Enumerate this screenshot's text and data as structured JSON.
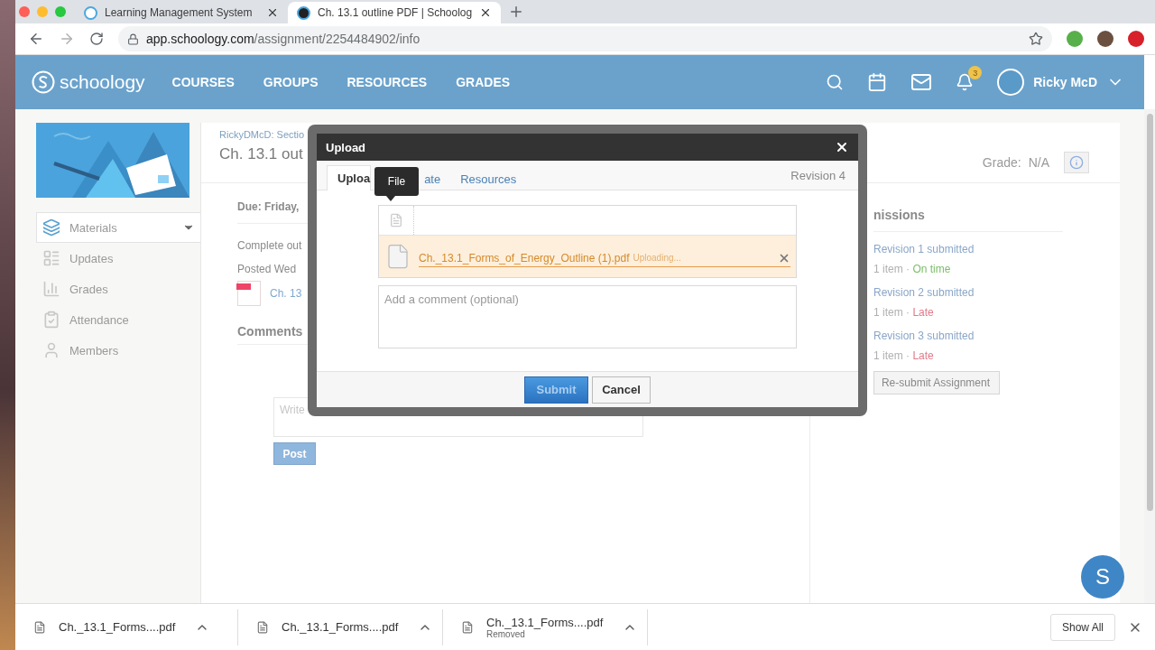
{
  "browser": {
    "tabs": [
      {
        "title": "Learning Management System",
        "selected": false
      },
      {
        "title": "Ch. 13.1 outline PDF | Schoolog",
        "selected": true
      }
    ],
    "url": {
      "host": "app.schoology.com",
      "path": "/assignment/2254484902/info"
    }
  },
  "header": {
    "logo": "schoology",
    "nav": [
      "COURSES",
      "GROUPS",
      "RESOURCES",
      "GRADES"
    ],
    "notification_count": "3",
    "user": "Ricky McD"
  },
  "sidebar": {
    "items": [
      {
        "label": "Materials",
        "kind": "materials",
        "selected": true
      },
      {
        "label": "Updates",
        "kind": "updates",
        "selected": false
      },
      {
        "label": "Grades",
        "kind": "grades",
        "selected": false
      },
      {
        "label": "Attendance",
        "kind": "attendance",
        "selected": false
      },
      {
        "label": "Members",
        "kind": "members",
        "selected": false
      }
    ]
  },
  "assignment": {
    "breadcrumb": "RickyDMcD: Sectio",
    "title": "Ch. 13.1 out",
    "due": "Due: Friday,",
    "description": "Complete out",
    "posted": "Posted Wed",
    "attachment": "Ch. 13",
    "comments_heading": "Comments",
    "comment_placeholder": "Write",
    "post_button": "Post"
  },
  "grade": {
    "label": "Grade:",
    "value": "N/A"
  },
  "submissions": {
    "heading": "nissions",
    "revisions": [
      {
        "title": "Revision 1 submitted",
        "items": "1 item",
        "separator": "·",
        "status": "On time",
        "color": "#7cbf6a"
      },
      {
        "title": "Revision 2 submitted",
        "items": "1 item",
        "separator": "·",
        "status": "Late",
        "color": "#e07a8a"
      },
      {
        "title": "Revision 3 submitted",
        "items": "1 item",
        "separator": "·",
        "status": "Late",
        "color": "#e07a8a"
      }
    ],
    "resubmit_button": "Re-submit Assignment"
  },
  "modal": {
    "title": "Upload",
    "tabs": [
      {
        "label": "Uploa",
        "selected": true
      },
      {
        "label": "ate",
        "selected": false
      },
      {
        "label": "Resources",
        "selected": false
      }
    ],
    "revision": "Revision 4",
    "tooltip": "File",
    "file": {
      "name": "Ch._13.1_Forms_of_Energy_Outline (1).pdf",
      "status": "Uploading..."
    },
    "comment_placeholder": "Add a comment (optional)",
    "submit_button": "Submit",
    "cancel_button": "Cancel"
  },
  "downloads": {
    "items": [
      {
        "name": "Ch._13.1_Forms....pdf"
      },
      {
        "name": "Ch._13.1_Forms....pdf"
      },
      {
        "name": "Ch._13.1_Forms....pdf",
        "status": "Removed"
      }
    ],
    "show_all": "Show All"
  },
  "chat": {
    "label": "S"
  }
}
